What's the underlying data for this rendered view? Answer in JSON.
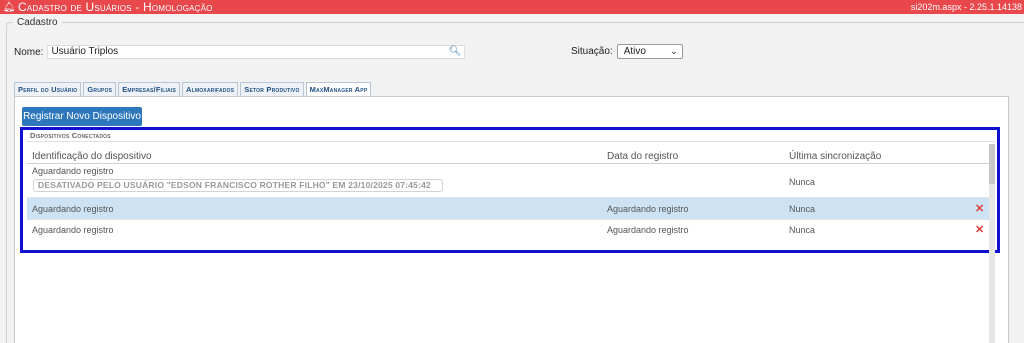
{
  "titlebar": {
    "bell_icon": "bell-icon",
    "title": "Cadastro de Usuários - Homologação",
    "version": "si202m.aspx - 2.25.1.14138"
  },
  "form": {
    "legend": "Cadastro",
    "name_label": "Nome:",
    "name_value": "Usuário Triplos",
    "search_icon": "search-icon",
    "situacao_label": "Situação:",
    "situacao_value": "Ativo"
  },
  "tabs": [
    {
      "label": "Perfil do Usuário",
      "active": false
    },
    {
      "label": "Grupos",
      "active": false
    },
    {
      "label": "Empresas/Filiais",
      "active": false
    },
    {
      "label": "Almoxarifados",
      "active": false
    },
    {
      "label": "Setor Produtivo",
      "active": false
    },
    {
      "label": "MaxManager App",
      "active": true
    }
  ],
  "devices": {
    "register_button": "Registrar Novo Dispositivo",
    "legend": "Dispositivos Conectados",
    "columns": [
      "Identificação do dispositivo",
      "Data do registro",
      "Última sincronização"
    ],
    "rows": [
      {
        "id": "Aguardando registro",
        "badge": "DESATIVADO PELO USUÁRIO \"EDSON FRANCISCO ROTHER FILHO\" EM 23/10/2025 07:45:42",
        "date": "",
        "sync": "Nunca",
        "deletable": false,
        "highlight": false
      },
      {
        "id": "Aguardando registro",
        "badge": "",
        "date": "Aguardando registro",
        "sync": "Nunca",
        "deletable": true,
        "highlight": true
      },
      {
        "id": "Aguardando registro",
        "badge": "",
        "date": "Aguardando registro",
        "sync": "Nunca",
        "deletable": true,
        "highlight": false
      }
    ],
    "delete_icon": "close-icon"
  },
  "colors": {
    "titlebar": "#e8474c",
    "accent": "#2d78bd",
    "highlight_box": "#1010d0",
    "row_highlight": "#cde3f3",
    "delete": "#e53935"
  }
}
